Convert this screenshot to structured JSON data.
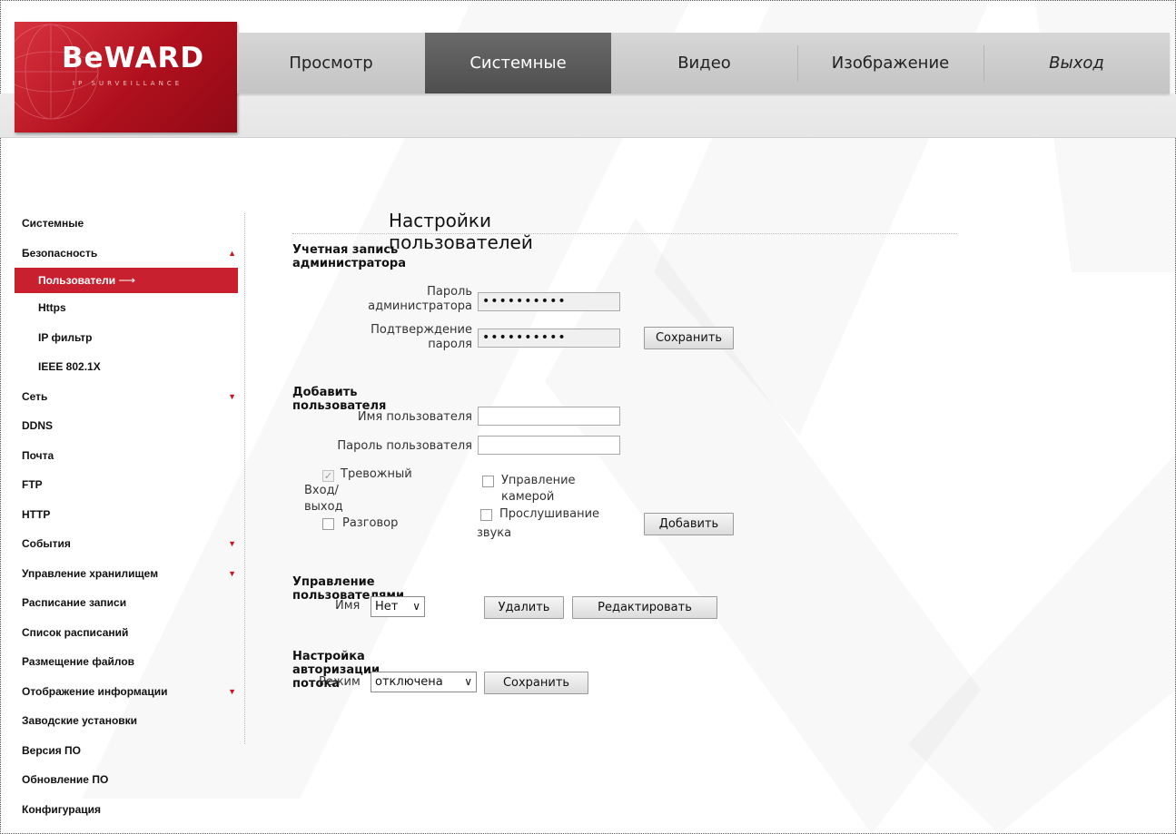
{
  "brand": {
    "name": "BeWARD",
    "tagline": "IP SURVEILLANCE"
  },
  "nav": {
    "tabs": [
      {
        "label": "Просмотр"
      },
      {
        "label": "Системные"
      },
      {
        "label": "Видео"
      },
      {
        "label": "Изображение"
      },
      {
        "label": "Выход"
      }
    ],
    "active": "Системные"
  },
  "sidebar": {
    "items": [
      {
        "label": "Системные"
      },
      {
        "label": "Безопасность",
        "expanded": true
      },
      {
        "label": "Пользователи",
        "active": true,
        "arrow": "⟶"
      },
      {
        "label": "Https"
      },
      {
        "label": "IP фильтр"
      },
      {
        "label": "IEEE 802.1X"
      },
      {
        "label": "Сеть",
        "collapsed": true
      },
      {
        "label": "DDNS"
      },
      {
        "label": "Почта"
      },
      {
        "label": "FTP"
      },
      {
        "label": "HTTP"
      },
      {
        "label": "События",
        "collapsed": true
      },
      {
        "label": "Управление хранилищем",
        "collapsed": true
      },
      {
        "label": "Расписание записи"
      },
      {
        "label": "Список расписаний"
      },
      {
        "label": "Размещение файлов"
      },
      {
        "label": "Отображение информации",
        "collapsed": true
      },
      {
        "label": "Заводские установки"
      },
      {
        "label": "Версия ПО"
      },
      {
        "label": "Обновление ПО"
      },
      {
        "label": "Конфигурация"
      }
    ]
  },
  "main": {
    "title": "Настройки пользователей",
    "admin": {
      "heading": "Учетная запись администратора",
      "password_label_1": "Пароль",
      "password_label_2": "администратора",
      "password_value": "••••••••••",
      "confirm_label_1": "Подтверждение",
      "confirm_label_2": "пароля",
      "confirm_value": "••••••••••",
      "save": "Сохранить"
    },
    "add_user": {
      "heading": "Добавить пользователя",
      "username_label": "Имя пользователя",
      "password_label": "Пароль пользователя",
      "alarm_label_1": "Тревожный",
      "alarm_label_2": "Вход/выход",
      "camera_control_label": "Управление камерой",
      "talk_label": "Разговор",
      "listen_label_1": "Прослушивание",
      "listen_label_2": "звука",
      "add": "Добавить"
    },
    "manage": {
      "heading": "Управление пользователями",
      "name_label": "Имя",
      "name_value": "Нет",
      "delete": "Удалить",
      "edit": "Редактировать"
    },
    "stream_auth": {
      "heading": "Настройка авторизации потока",
      "mode_label": "Режим",
      "mode_value": "отключена",
      "save": "Сохранить"
    }
  },
  "colors": {
    "accent": "#c8202e",
    "nav_active": "#555555",
    "nav_bg": "#cccccc"
  }
}
